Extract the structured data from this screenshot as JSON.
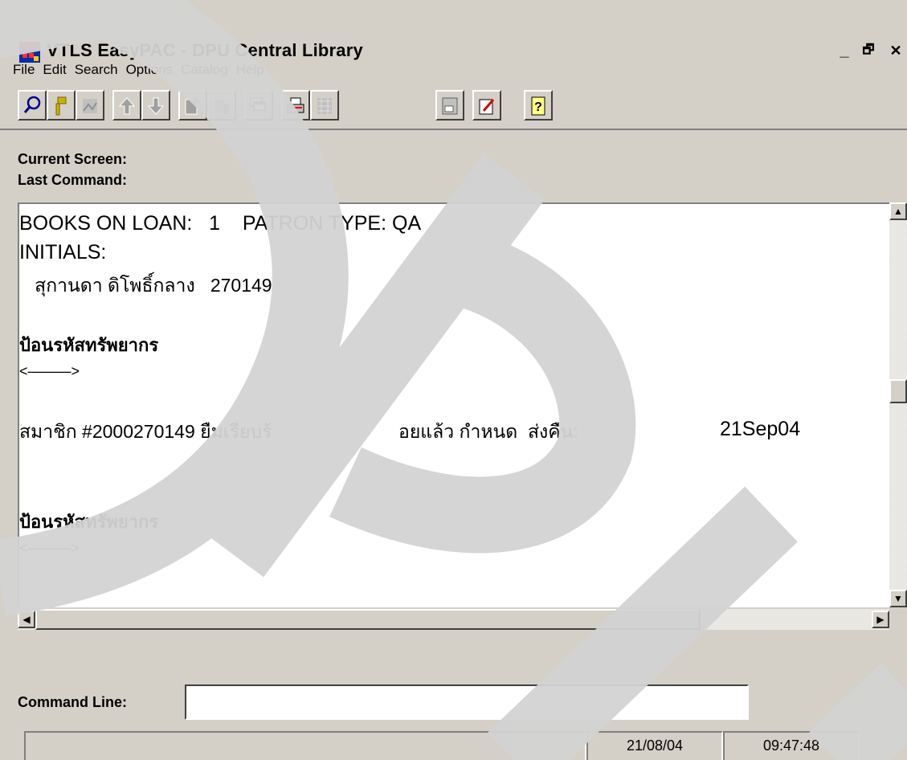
{
  "window": {
    "title": "VTLS EasyPAC - DPU Central Library",
    "controls": {
      "minimize": "_",
      "restore": "🗗",
      "close": "✕"
    }
  },
  "menu": [
    "File",
    "Edit",
    "Search",
    "Options",
    "Catalog",
    "Help"
  ],
  "toolbar": [
    {
      "name": "search-icon"
    },
    {
      "name": "key-icon"
    },
    {
      "name": "image-icon"
    },
    {
      "name": "up-arrow-icon"
    },
    {
      "name": "down-arrow-icon"
    },
    {
      "name": "document-icon"
    },
    {
      "name": "document-grey-icon"
    },
    {
      "name": "windows-icon"
    },
    {
      "name": "printer-icon"
    },
    {
      "name": "network-icon"
    },
    {
      "name": "form-icon"
    },
    {
      "name": "edit-icon"
    },
    {
      "name": "help-icon"
    }
  ],
  "labels": {
    "current_screen": "Current Screen:",
    "last_command": "Last Command:",
    "command_line": "Command Line:"
  },
  "screen": {
    "line1": "BOOKS ON LOAN:   1    PATRON TYPE: QA",
    "line2": "INITIALS:",
    "line3": "   สุกานดา ดิโพธิ์กลาง   270149",
    "prompt1": "ป้อนรหัสทรัพยากร",
    "arrow1": "<———>",
    "line4_left": "สมาชิก #2000270149 ยืมเรียบร้",
    "line4_mid": "อยแล้ว กำหนด  ส่งคืน:",
    "line4_date": "21Sep04",
    "prompt2": "ป้อนรหัสทรัพยากร",
    "arrow2": "<———>"
  },
  "command_value": "",
  "status": {
    "date": "21/08/04",
    "time": "09:47:48"
  },
  "colors": {
    "face": "#d4d0c8",
    "shadow": "#808080",
    "watermark": "#d3d3d3"
  }
}
